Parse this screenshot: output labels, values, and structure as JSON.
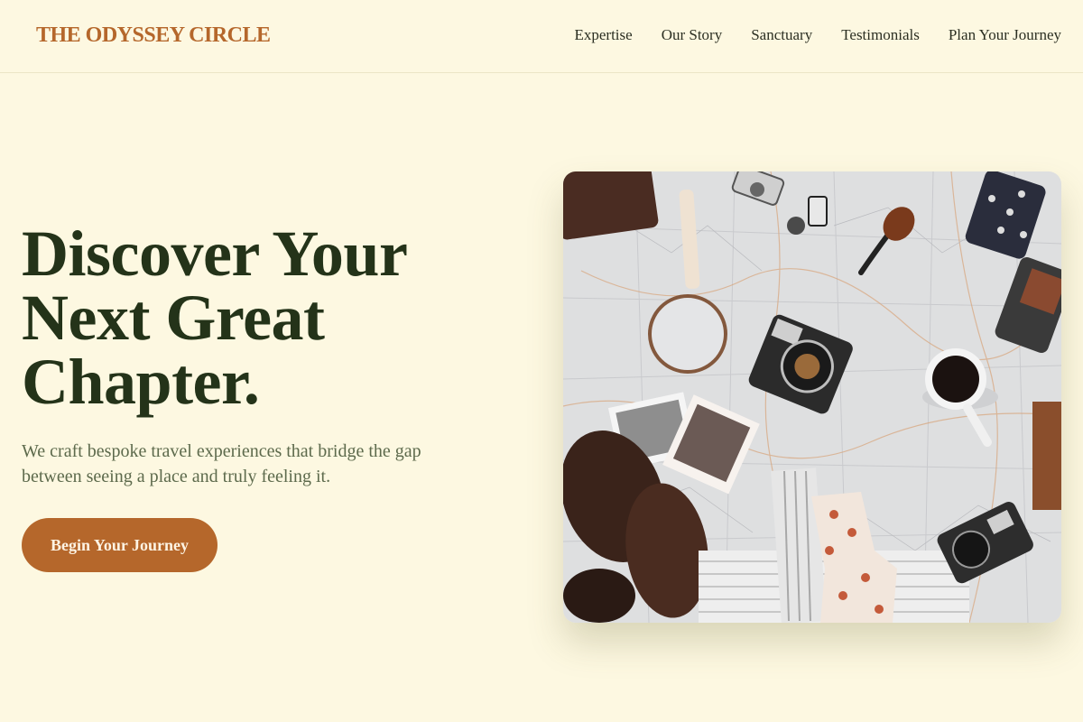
{
  "header": {
    "logo": "THE ODYSSEY CIRCLE",
    "nav": [
      {
        "label": "Expertise"
      },
      {
        "label": "Our Story"
      },
      {
        "label": "Sanctuary"
      },
      {
        "label": "Testimonials"
      },
      {
        "label": "Plan Your Journey"
      }
    ]
  },
  "hero": {
    "title_line1": "Discover Your",
    "title_line2": "Next Great",
    "title_line3": "Chapter.",
    "subtitle": "We craft bespoke travel experiences that bridge the gap between seeing a place and truly feeling it.",
    "cta_label": "Begin Your Journey",
    "image_alt": "Flat lay of a map with vintage cameras, a magnifying glass, photographs, coffee, boots and a pipe"
  },
  "colors": {
    "background": "#fdf8e1",
    "accent": "#b5672b",
    "heading": "#243319",
    "body_text": "#5d6a4c"
  }
}
